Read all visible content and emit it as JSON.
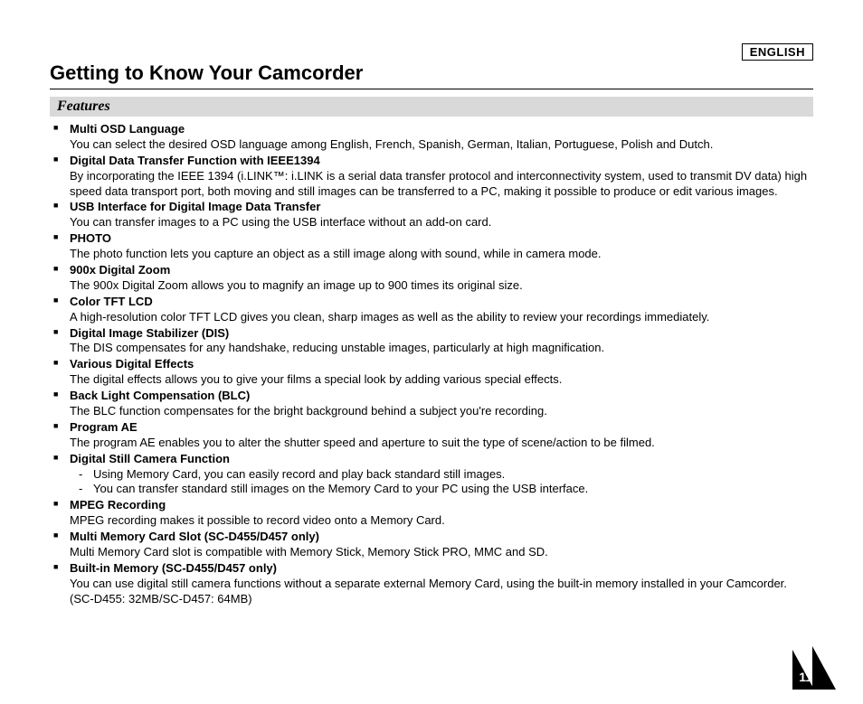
{
  "language_tag": "ENGLISH",
  "title": "Getting to Know Your Camcorder",
  "section_header": "Features",
  "page_number": "11",
  "features": [
    {
      "title": "Multi OSD Language",
      "desc": "You can select the desired OSD language among English, French, Spanish, German, Italian, Portuguese, Polish and Dutch."
    },
    {
      "title": "Digital Data Transfer Function with IEEE1394",
      "desc": "By incorporating the IEEE 1394 (i.LINK™: i.LINK is a serial data transfer protocol and interconnectivity system, used to transmit DV data) high speed data transport port, both moving and still images can be transferred to a PC, making it possible to produce or edit various images."
    },
    {
      "title": "USB Interface for Digital Image Data Transfer",
      "desc": "You can transfer images to a PC using the USB interface without an add-on card."
    },
    {
      "title": "PHOTO",
      "desc": "The photo function lets you capture an object as a still image along with sound, while in camera mode."
    },
    {
      "title": "900x Digital Zoom",
      "desc": "The 900x Digital Zoom allows you to magnify an image up to 900 times its original size."
    },
    {
      "title": "Color TFT LCD",
      "desc": "A high-resolution color TFT LCD gives you clean, sharp images as well as the ability to review your recordings immediately."
    },
    {
      "title": "Digital Image Stabilizer (DIS)",
      "desc": "The DIS compensates for any handshake, reducing unstable images, particularly at high magnification."
    },
    {
      "title": "Various Digital Effects",
      "desc": "The digital effects allows you to give your films a special look by adding various special effects."
    },
    {
      "title": "Back Light Compensation (BLC)",
      "desc": "The BLC function compensates for the bright background behind a subject you're recording."
    },
    {
      "title": "Program AE",
      "desc": "The program AE enables you to alter the shutter speed and aperture to suit the type of scene/action to be filmed."
    },
    {
      "title": "Digital Still Camera Function",
      "sub": [
        "Using Memory Card, you can easily record and play back standard still images.",
        "You can transfer standard still images on the Memory Card to your PC using the USB interface."
      ]
    },
    {
      "title": "MPEG Recording",
      "desc": "MPEG recording makes it possible to record video onto a Memory Card."
    },
    {
      "title": "Multi Memory Card Slot (SC-D455/D457 only)",
      "desc": "Multi Memory Card slot is compatible with Memory Stick, Memory Stick PRO, MMC and SD."
    },
    {
      "title": "Built-in Memory (SC-D455/D457 only)",
      "desc": "You can use digital still camera functions without a separate external Memory Card, using the built-in memory installed in your Camcorder. (SC-D455: 32MB/SC-D457: 64MB)"
    }
  ]
}
